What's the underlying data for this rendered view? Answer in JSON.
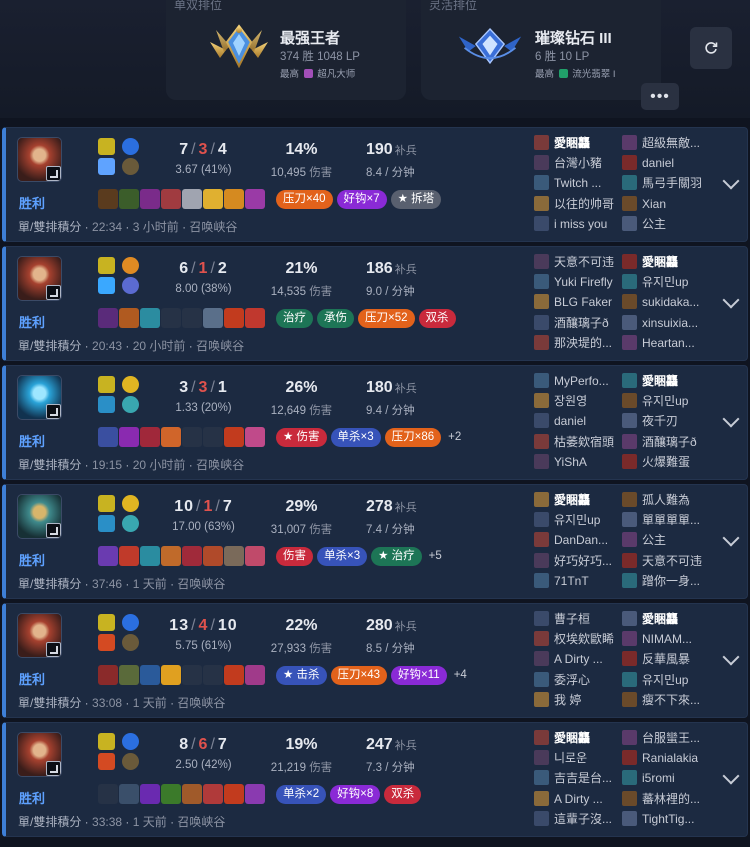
{
  "ranks": {
    "solo": {
      "queue": "单双排位",
      "tier": "最强王者",
      "stats": "374 胜 1048 LP",
      "peak_prefix": "最高",
      "peak_tier": "超凡大师"
    },
    "flex": {
      "queue": "灵活排位",
      "tier": "璀璨钻石 III",
      "stats": "6 胜 10 LP",
      "peak_prefix": "最高",
      "peak_tier": "流光翡翠 I"
    }
  },
  "labels": {
    "cs_unit": "补兵",
    "dmg_unit": "伤害",
    "per_min": "/ 分钟"
  },
  "matches": [
    {
      "result": "胜利",
      "queue": "單/雙排積分",
      "duration": "22:34",
      "ago": "3 小时前",
      "map": "召唤峡谷",
      "kills": "7",
      "deaths": "3",
      "assists": "4",
      "kda_ratio": "3.67",
      "kp": "(41%)",
      "dmg_pct": "14%",
      "damage": "10,495",
      "cs": "190",
      "cs_per_min": "8.4",
      "tags": [
        {
          "text": "压刀×40",
          "c": "orange"
        },
        {
          "text": "好钩×7",
          "c": "purple"
        },
        {
          "text": "★ 拆塔",
          "c": "gray"
        }
      ],
      "team_a": [
        "愛睏龘",
        "台灣小豬",
        "Twitch ...",
        "以往的帅哥",
        "i miss you"
      ],
      "team_b": [
        "超級無敵...",
        "daniel",
        "馬弓手關羽",
        "Xian",
        "公主"
      ],
      "me_side": "a",
      "me_index": 0
    },
    {
      "result": "胜利",
      "queue": "單/雙排積分",
      "duration": "20:43",
      "ago": "20 小时前",
      "map": "召唤峡谷",
      "kills": "6",
      "deaths": "1",
      "assists": "2",
      "kda_ratio": "8.00",
      "kp": "(38%)",
      "dmg_pct": "21%",
      "damage": "14,535",
      "cs": "186",
      "cs_per_min": "9.0",
      "tags": [
        {
          "text": "治疗",
          "c": "green"
        },
        {
          "text": "承伤",
          "c": "green"
        },
        {
          "text": "压刀×52",
          "c": "orange"
        },
        {
          "text": "双杀",
          "c": "red"
        }
      ],
      "team_a": [
        "天意不可违",
        "Yuki Firefly",
        "BLG Faker",
        "酒釀璃子ð",
        "那泱堤的..."
      ],
      "team_b": [
        "愛睏龘",
        "유지민up",
        "sukidaka...",
        "xinsuixia...",
        "Heartan..."
      ],
      "me_side": "b",
      "me_index": 0
    },
    {
      "result": "胜利",
      "queue": "單/雙排積分",
      "duration": "19:15",
      "ago": "20 小时前",
      "map": "召唤峡谷",
      "kills": "3",
      "deaths": "3",
      "assists": "1",
      "kda_ratio": "1.33",
      "kp": "(20%)",
      "dmg_pct": "26%",
      "damage": "12,649",
      "cs": "180",
      "cs_per_min": "9.4",
      "tags": [
        {
          "text": "★ 伤害",
          "c": "red"
        },
        {
          "text": "单杀×3",
          "c": "blue"
        },
        {
          "text": "压刀×86",
          "c": "orange"
        },
        {
          "text": "+2",
          "c": "more"
        }
      ],
      "team_a": [
        "MyPerfo...",
        "장원영",
        "daniel",
        "枯萎欸宿頭",
        "YiShA"
      ],
      "team_b": [
        "愛睏龘",
        "유지민up",
        "夜千刃",
        "酒釀璃子ð",
        "火爆難蛋"
      ],
      "me_side": "b",
      "me_index": 0
    },
    {
      "result": "胜利",
      "queue": "單/雙排積分",
      "duration": "37:46",
      "ago": "1 天前",
      "map": "召唤峡谷",
      "kills": "10",
      "deaths": "1",
      "assists": "7",
      "kda_ratio": "17.00",
      "kp": "(63%)",
      "dmg_pct": "29%",
      "damage": "31,007",
      "cs": "278",
      "cs_per_min": "7.4",
      "tags": [
        {
          "text": "伤害",
          "c": "red"
        },
        {
          "text": "单杀×3",
          "c": "blue"
        },
        {
          "text": "★ 治疗",
          "c": "green"
        },
        {
          "text": "+5",
          "c": "more"
        }
      ],
      "team_a": [
        "愛睏龘",
        "유지민up",
        "DanDan...",
        "好巧好巧...",
        "71TnT"
      ],
      "team_b": [
        "孤人難為",
        "單單單單...",
        "公主",
        "天意不可违",
        "蹭你一身..."
      ],
      "me_side": "a",
      "me_index": 0
    },
    {
      "result": "胜利",
      "queue": "單/雙排積分",
      "duration": "33:08",
      "ago": "1 天前",
      "map": "召唤峡谷",
      "kills": "13",
      "deaths": "4",
      "assists": "10",
      "kda_ratio": "5.75",
      "kp": "(61%)",
      "dmg_pct": "22%",
      "damage": "27,933",
      "cs": "280",
      "cs_per_min": "8.5",
      "tags": [
        {
          "text": "★ 击杀",
          "c": "blue"
        },
        {
          "text": "压刀×43",
          "c": "orange"
        },
        {
          "text": "好钩×11",
          "c": "purple"
        },
        {
          "text": "+4",
          "c": "more"
        }
      ],
      "team_a": [
        "曹子桓",
        "权埃欸歐睎",
        "A Dirty ...",
        "委浮心",
        "我 婷"
      ],
      "team_b": [
        "愛睏龘",
        "NIMAM...",
        "反華風暴",
        "유지민up",
        "瘦不下來..."
      ],
      "me_side": "b",
      "me_index": 0
    },
    {
      "result": "胜利",
      "queue": "單/雙排積分",
      "duration": "33:38",
      "ago": "1 天前",
      "map": "召唤峡谷",
      "kills": "8",
      "deaths": "6",
      "assists": "7",
      "kda_ratio": "2.50",
      "kp": "(42%)",
      "dmg_pct": "19%",
      "damage": "21,219",
      "cs": "247",
      "cs_per_min": "7.3",
      "tags": [
        {
          "text": "单杀×2",
          "c": "blue"
        },
        {
          "text": "好钩×8",
          "c": "purple"
        },
        {
          "text": "双杀",
          "c": "red"
        }
      ],
      "team_a": [
        "愛睏龘",
        "니로운",
        "吉吉是台...",
        "A Dirty ...",
        "這輩子沒..."
      ],
      "team_b": [
        "台服蠻王...",
        "Ranialakia",
        "i5romi",
        "蕃林裡的...",
        "TightTig..."
      ],
      "me_side": "a",
      "me_index": 0
    }
  ],
  "colors": {
    "win_accent": "#3e7fd6",
    "card_bg": "#1c2a41",
    "kda_death": "#e0524d"
  },
  "icons": {
    "refresh": "refresh-icon",
    "more": "more-icon",
    "expand": "chevron-down-icon"
  }
}
